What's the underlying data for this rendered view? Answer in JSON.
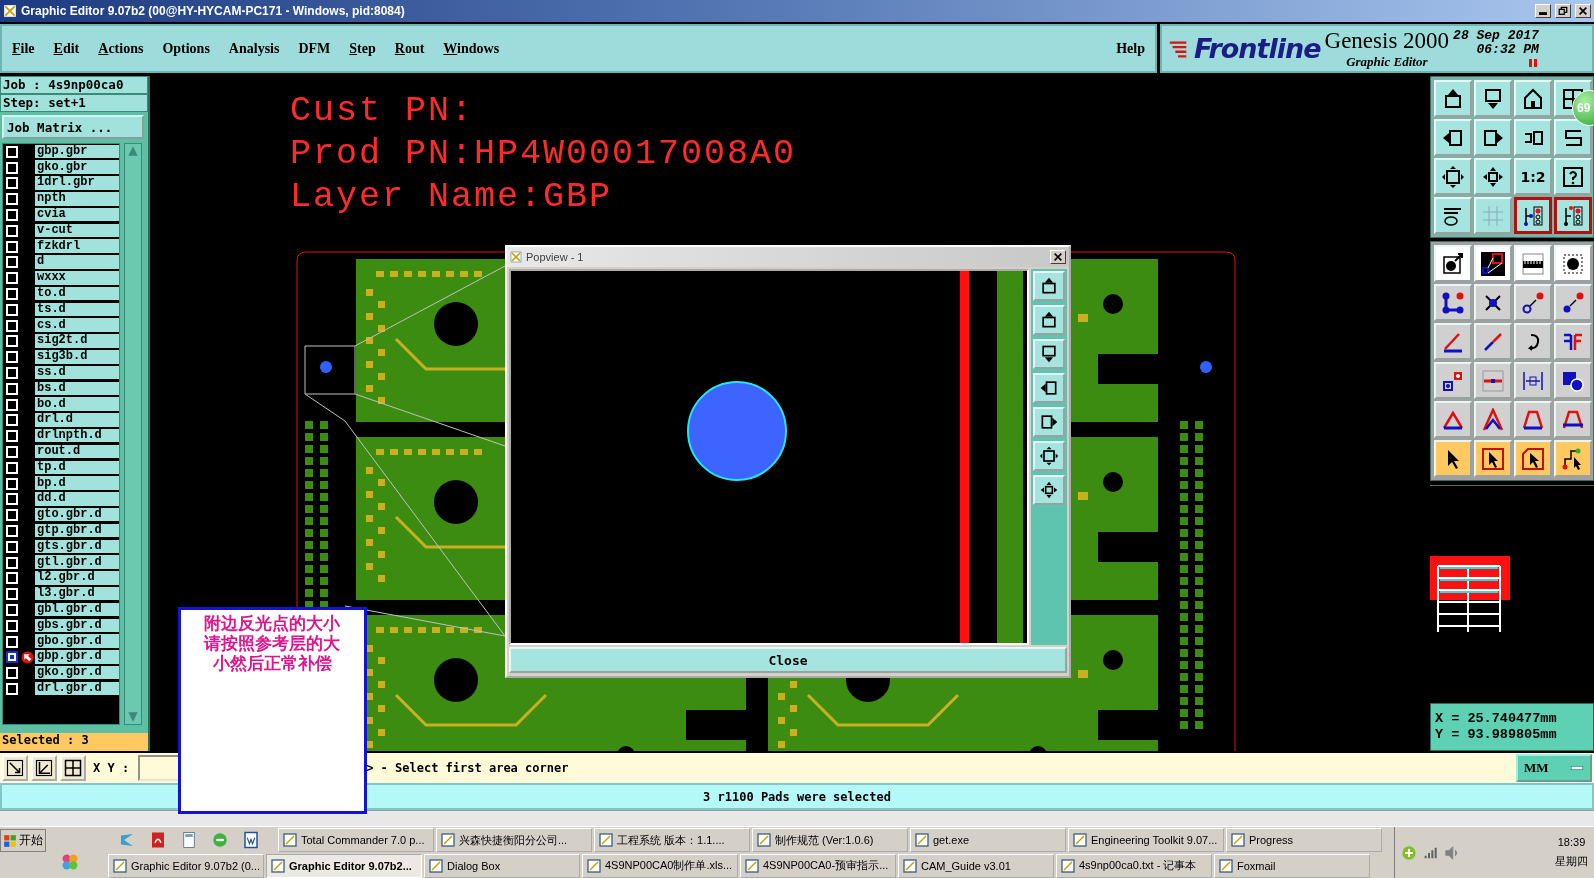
{
  "window": {
    "title": "Graphic Editor 9.07b2 (00@HY-HYCAM-PC171 - Windows, pid:8084)"
  },
  "menu": [
    {
      "label": "File",
      "mnemonic": true
    },
    {
      "label": "Edit",
      "mnemonic": true
    },
    {
      "label": "Actions",
      "mnemonic": true
    },
    {
      "label": "Options",
      "mnemonic": false
    },
    {
      "label": "Analysis",
      "mnemonic": false
    },
    {
      "label": "DFM",
      "mnemonic": false
    },
    {
      "label": "Step",
      "mnemonic": true
    },
    {
      "label": "Rout",
      "mnemonic": true
    },
    {
      "label": "Windows",
      "mnemonic": true
    }
  ],
  "help": "Help",
  "brand": {
    "logo": "Frontline",
    "product": "Genesis 2000",
    "subtitle": "Graphic Editor",
    "date": "28 Sep 2017",
    "time": "06:32 PM"
  },
  "job_panel": {
    "job": "Job : 4s9np00ca0",
    "step": "Step: set+1",
    "matrix_button": "Job Matrix ...",
    "selected_count": "Selected : 3",
    "layers": [
      {
        "name": "gbp.gbr",
        "selected": false
      },
      {
        "name": "gko.gbr",
        "selected": false
      },
      {
        "name": "1drl.gbr",
        "selected": false
      },
      {
        "name": "npth",
        "selected": false
      },
      {
        "name": "cvia",
        "selected": false
      },
      {
        "name": "v-cut",
        "selected": false
      },
      {
        "name": "fzkdrl",
        "selected": false
      },
      {
        "name": "d",
        "selected": false
      },
      {
        "name": "wxxx",
        "selected": false
      },
      {
        "name": "to.d",
        "selected": false
      },
      {
        "name": "ts.d",
        "selected": false
      },
      {
        "name": "cs.d",
        "selected": false
      },
      {
        "name": "sig2t.d",
        "selected": false
      },
      {
        "name": "sig3b.d",
        "selected": false
      },
      {
        "name": "ss.d",
        "selected": false
      },
      {
        "name": "bs.d",
        "selected": false
      },
      {
        "name": "bo.d",
        "selected": false
      },
      {
        "name": "drl.d",
        "selected": false
      },
      {
        "name": "drlnpth.d",
        "selected": false
      },
      {
        "name": "rout.d",
        "selected": false
      },
      {
        "name": "tp.d",
        "selected": false
      },
      {
        "name": "bp.d",
        "selected": false
      },
      {
        "name": "dd.d",
        "selected": false
      },
      {
        "name": "gto.gbr.d",
        "selected": false
      },
      {
        "name": "gtp.gbr.d",
        "selected": false
      },
      {
        "name": "gts.gbr.d",
        "selected": false
      },
      {
        "name": "gtl.gbr.d",
        "selected": false
      },
      {
        "name": "l2.gbr.d",
        "selected": false
      },
      {
        "name": "l3.gbr.d",
        "selected": false
      },
      {
        "name": "gbl.gbr.d",
        "selected": false
      },
      {
        "name": "gbs.gbr.d",
        "selected": false
      },
      {
        "name": "gbo.gbr.d",
        "selected": false
      },
      {
        "name": "gbp.gbr.d",
        "selected": true
      },
      {
        "name": "gko.gbr.d",
        "selected": false
      },
      {
        "name": "drl.gbr.d",
        "selected": false
      }
    ]
  },
  "canvas": {
    "lines": [
      "Cust PN:",
      "Prod PN:HP4W00017008A0",
      "Layer Name:GBP"
    ]
  },
  "popview": {
    "title": "Popview - 1",
    "close_button": "Close"
  },
  "note": "附边反光点的大小请按照参考层的大小然后正常补偿",
  "badge": "69",
  "tools": [
    {
      "kind": "teal",
      "on": false
    },
    {
      "kind": "teal",
      "on": false
    },
    {
      "kind": "teal",
      "on": false
    },
    {
      "kind": "teal",
      "on": false
    },
    {
      "kind": "teal",
      "on": false
    },
    {
      "kind": "teal",
      "on": false
    },
    {
      "kind": "teal",
      "on": false
    },
    {
      "kind": "teal",
      "on": false
    },
    {
      "kind": "teal",
      "on": false
    },
    {
      "kind": "teal",
      "on": false
    },
    {
      "kind": "teal",
      "on": false,
      "label": "1:2"
    },
    {
      "kind": "teal",
      "on": false
    },
    {
      "kind": "teal",
      "on": false
    },
    {
      "kind": "teal",
      "on": false
    },
    {
      "kind": "teal",
      "on": true
    },
    {
      "kind": "teal",
      "on": true
    },
    {
      "kind": "white",
      "on": false
    },
    {
      "kind": "white",
      "on": false
    },
    {
      "kind": "white",
      "on": false
    },
    {
      "kind": "white",
      "on": false
    },
    {
      "kind": "gray",
      "on": false
    },
    {
      "kind": "gray",
      "on": false
    },
    {
      "kind": "gray",
      "on": false
    },
    {
      "kind": "gray",
      "on": false
    },
    {
      "kind": "gray",
      "on": false
    },
    {
      "kind": "gray",
      "on": false
    },
    {
      "kind": "gray",
      "on": false
    },
    {
      "kind": "gray",
      "on": false
    },
    {
      "kind": "gray",
      "on": false
    },
    {
      "kind": "gray",
      "on": false
    },
    {
      "kind": "gray",
      "on": false
    },
    {
      "kind": "gray",
      "on": false
    },
    {
      "kind": "gray",
      "on": false
    },
    {
      "kind": "gray",
      "on": false
    },
    {
      "kind": "gray",
      "on": false
    },
    {
      "kind": "gray",
      "on": false
    },
    {
      "kind": "orange",
      "on": false
    },
    {
      "kind": "orange",
      "on": false
    },
    {
      "kind": "orange",
      "on": false
    },
    {
      "kind": "orange",
      "on": false
    }
  ],
  "coords": {
    "x": "X = 25.740477mm",
    "y": "Y = 93.989805mm"
  },
  "command": {
    "label": "X Y :",
    "prompt": "> - Select first area corner",
    "units": "MM"
  },
  "status": "3 r1100 Pads were selected",
  "taskbar": {
    "start": "开始",
    "clock": "18:39",
    "weekday": "星期四",
    "top_tasks": [
      {
        "label": "Total Commander 7.0 p...",
        "selected": false
      },
      {
        "label": "兴森快捷衡阳分公司...",
        "selected": false
      },
      {
        "label": "工程系统  版本：1.1....",
        "selected": false
      },
      {
        "label": "制作规范 (Ver:1.0.6)",
        "selected": false
      },
      {
        "label": "get.exe",
        "selected": false
      },
      {
        "label": "Engineering Toolkit 9.07...",
        "selected": false
      },
      {
        "label": "Progress",
        "selected": false
      }
    ],
    "bottom_tasks": [
      {
        "label": "Graphic Editor 9.07b2 (0...",
        "selected": false
      },
      {
        "label": "Graphic Editor 9.07b2...",
        "selected": true
      },
      {
        "label": "Dialog Box",
        "selected": false
      },
      {
        "label": "4S9NP00CA0制作单.xls...",
        "selected": false
      },
      {
        "label": "4S9NP00CA0-预审指示...",
        "selected": false
      },
      {
        "label": "CAM_Guide v3.01",
        "selected": false
      },
      {
        "label": "4s9np00ca0.txt - 记事本",
        "selected": false
      },
      {
        "label": "Foxmail",
        "selected": false
      }
    ]
  }
}
